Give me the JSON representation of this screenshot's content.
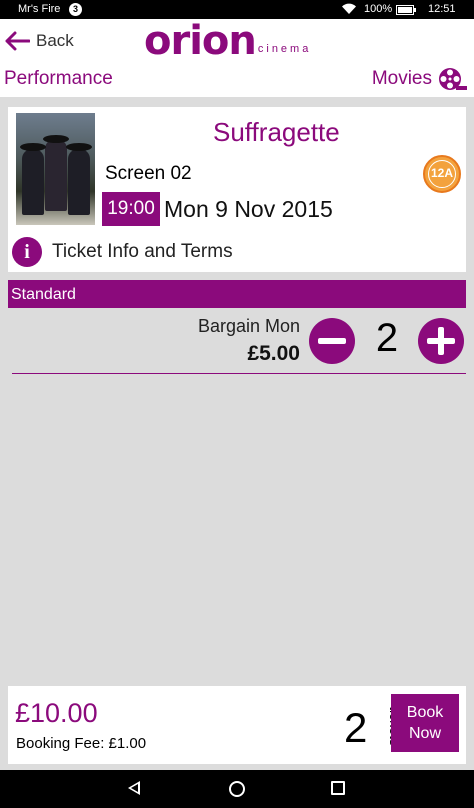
{
  "status_bar": {
    "device_name": "Mr's Fire",
    "notification_count": "3",
    "battery": "100%",
    "time": "12:51"
  },
  "header": {
    "back_label": "Back",
    "logo_main": "orion",
    "logo_sub": "cinema",
    "nav_left": "Performance",
    "nav_right": "Movies"
  },
  "film": {
    "title": "Suffragette",
    "screen": "Screen 02",
    "rating": "12A",
    "time": "19:00",
    "date": "Mon 9 Nov 2015",
    "info_label": "Ticket Info and Terms"
  },
  "tickets": {
    "section_label": "Standard",
    "items": [
      {
        "name": "Bargain Mon",
        "price": "£5.00",
        "quantity": "2"
      }
    ]
  },
  "summary": {
    "total": "£10.00",
    "booking_fee": "Booking Fee: £1.00",
    "ticket_count": "2",
    "tickets_label": "tickets",
    "book_label_line1": "Book",
    "book_label_line2": "Now"
  },
  "colors": {
    "brand": "#8b0a7c",
    "background": "#dcdcdc",
    "rating_orange": "#f3a23d"
  }
}
